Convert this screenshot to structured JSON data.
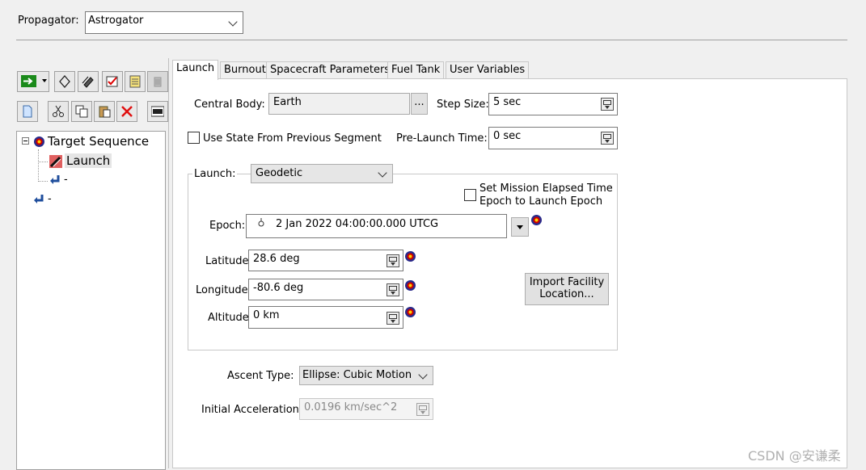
{
  "propagator": {
    "label": "Propagator:",
    "value": "Astrogator"
  },
  "toolbar": {
    "row1": [
      "run-icon",
      "dropdown-arrow-icon",
      "diamond-icon",
      "stack-icon",
      "checklist-icon",
      "notes-icon",
      "trash-icon"
    ],
    "row2": [
      "new-page-icon",
      "cut-icon",
      "copy-icon",
      "paste-icon",
      "delete-icon",
      "mcs-icon"
    ]
  },
  "tree": {
    "root": "Target Sequence",
    "child": "Launch",
    "return1": "-",
    "return2": "-"
  },
  "tabs": [
    "Launch",
    "Burnout",
    "Spacecraft Parameters",
    "Fuel Tank",
    "User Variables"
  ],
  "launch": {
    "central_body_label": "Central Body:",
    "central_body_value": "Earth",
    "browse_label": "...",
    "step_size_label": "Step Size:",
    "step_size_value": "5 sec",
    "use_state_label": "Use State From Previous Segment",
    "pre_launch_label": "Pre-Launch Time:",
    "pre_launch_value": "0 sec",
    "launch_label": "Launch:",
    "launch_type": "Geodetic",
    "set_mission_line1": "Set Mission Elapsed Time",
    "set_mission_line2": "Epoch to Launch Epoch",
    "epoch_label": "Epoch:",
    "epoch_value": "2 Jan 2022 04:00:00.000 UTCG",
    "latitude_label": "Latitude:",
    "latitude_value": "28.6 deg",
    "longitude_label": "Longitude:",
    "longitude_value": "-80.6 deg",
    "altitude_label": "Altitude:",
    "altitude_value": "0 km",
    "import_line1": "Import Facility",
    "import_line2": "Location...",
    "ascent_label": "Ascent Type:",
    "ascent_value": "Ellipse: Cubic Motion",
    "accel_label": "Initial Acceleration:",
    "accel_value": "0.0196 km/sec^2"
  },
  "watermark": "CSDN @安谦柔"
}
